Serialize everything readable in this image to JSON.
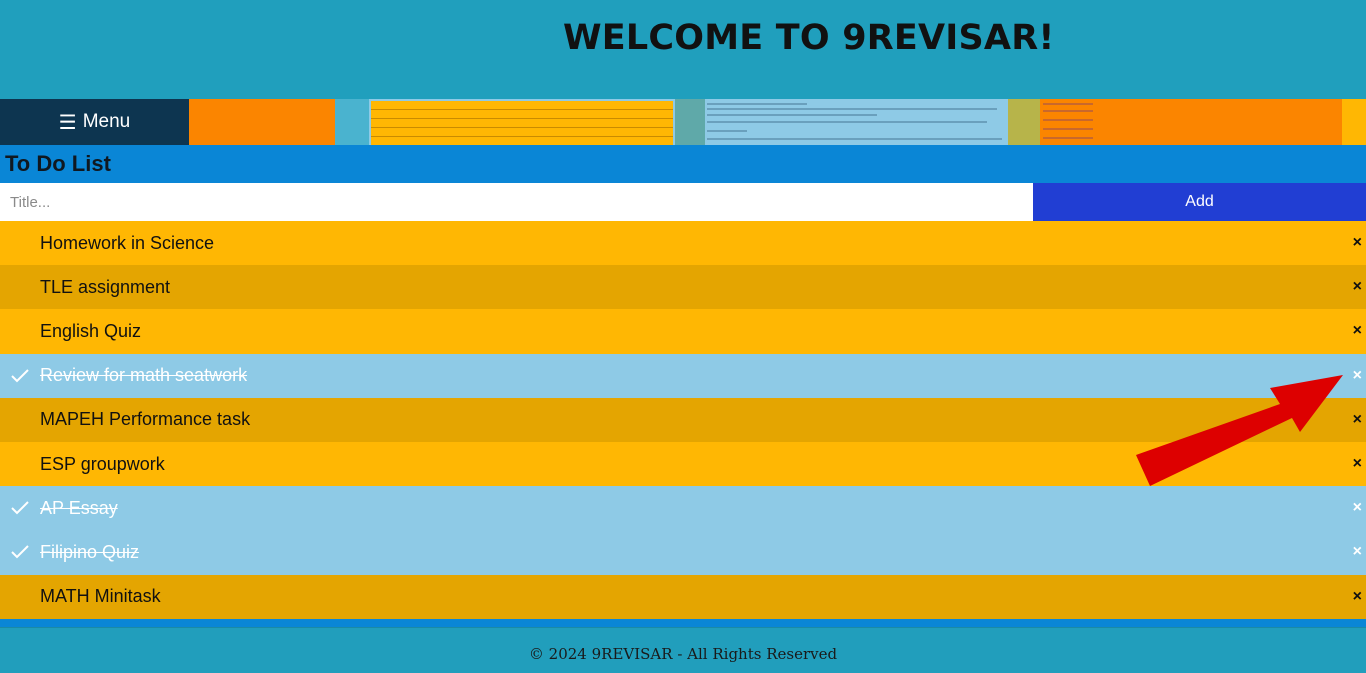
{
  "header": {
    "title": "WELCOME TO 9REVISAR!"
  },
  "nav": {
    "menu_label": "Menu",
    "menu_icon": "hamburger-icon"
  },
  "todo": {
    "heading": "To Do List",
    "input_placeholder": "Title...",
    "input_value": "",
    "add_label": "Add",
    "items": [
      {
        "label": "Homework in Science",
        "checked": false
      },
      {
        "label": "TLE assignment",
        "checked": false
      },
      {
        "label": "English Quiz",
        "checked": false
      },
      {
        "label": "Review for math seatwork",
        "checked": true
      },
      {
        "label": "MAPEH Performance task",
        "checked": false
      },
      {
        "label": "ESP groupwork",
        "checked": false
      },
      {
        "label": "AP Essay",
        "checked": true
      },
      {
        "label": "Filipino Quiz",
        "checked": true
      },
      {
        "label": "MATH Minitask",
        "checked": false
      }
    ],
    "close_symbol": "×"
  },
  "footer": {
    "text": "© 2024 9REVISAR - All Rights Reserved"
  },
  "colors": {
    "header_bg": "#209fbd",
    "menu_bg": "#0d3550",
    "section_bg": "#0a86d6",
    "add_button": "#213ed3",
    "item_odd": "#ffb703",
    "item_even": "#e4a501",
    "item_checked": "#8ecae6",
    "annotation_arrow": "#dd0000"
  }
}
